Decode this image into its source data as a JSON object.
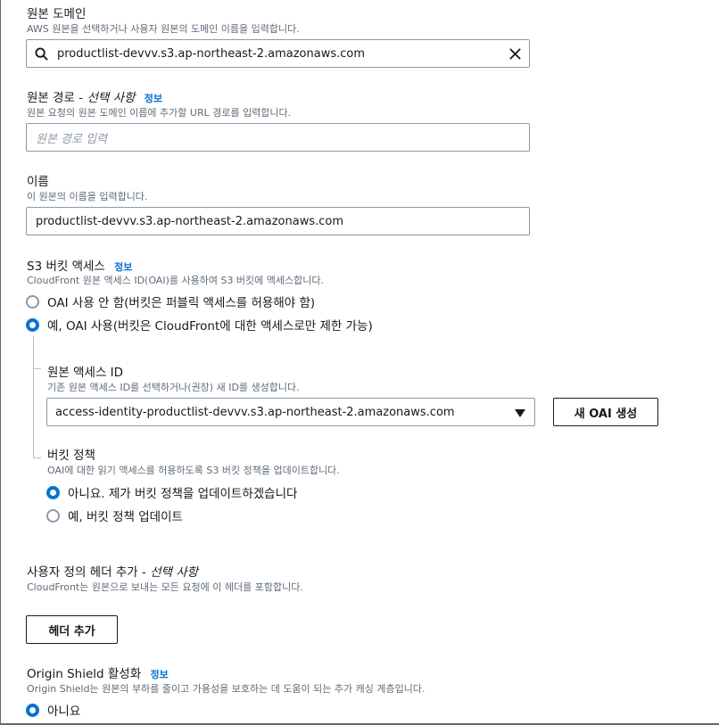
{
  "origin_domain": {
    "label": "원본 도메인",
    "description": "AWS 원본을 선택하거나 사용자 원본의 도메인 이름을 입력합니다.",
    "value": "productlist-devvv.s3.ap-northeast-2.amazonaws.com",
    "search_icon": "search-icon",
    "clear_icon": "close-icon"
  },
  "origin_path": {
    "label": "원본 경로 -",
    "optional": "선택 사항",
    "info": "정보",
    "description": "원본 요청의 원본 도메인 이름에 추가할 URL 경로를 입력합니다.",
    "placeholder": "원본 경로 입력"
  },
  "name": {
    "label": "이름",
    "description": "이 원본의 이름을 입력합니다.",
    "value": "productlist-devvv.s3.ap-northeast-2.amazonaws.com"
  },
  "s3_access": {
    "label": "S3 버킷 액세스",
    "info": "정보",
    "description": "CloudFront 원본 액세스 ID(OAI)를 사용하여 S3 버킷에 액세스합니다.",
    "options": [
      {
        "label": "OAI 사용 안 함(버킷은 퍼블릭 액세스를 허용해야 함)",
        "selected": false
      },
      {
        "label": "예, OAI 사용(버킷은 CloudFront에 대한 액세스로만 제한 가능)",
        "selected": true
      }
    ]
  },
  "oai": {
    "label": "원본 액세스 ID",
    "description": "기존 원본 액세스 ID를 선택하거나(권장) 새 ID를 생성합니다.",
    "selected": "access-identity-productlist-devvv.s3.ap-northeast-2.amazonaws.com",
    "create_button": "새 OAI 생성"
  },
  "bucket_policy": {
    "label": "버킷 정책",
    "description": "OAI에 대한 읽기 액세스를 허용하도록 S3 버킷 정책을 업데이트합니다.",
    "options": [
      {
        "label": "아니요. 제가 버킷 정책을 업데이트하겠습니다",
        "selected": true
      },
      {
        "label": "예, 버킷 정책 업데이트",
        "selected": false
      }
    ]
  },
  "custom_headers": {
    "label": "사용자 정의 헤더 추가 -",
    "optional": "선택 사항",
    "description": "CloudFront는 원본으로 보내는 모든 요청에 이 헤더를 포함합니다.",
    "add_button": "헤더 추가"
  },
  "origin_shield": {
    "label": "Origin Shield 활성화",
    "info": "정보",
    "description": "Origin Shield는 원본의 부하를 줄이고 가용성을 보호하는 데 도움이 되는 추가 캐싱 계층입니다.",
    "options": [
      {
        "label": "아니요",
        "selected": true
      }
    ]
  },
  "colors": {
    "accent": "#0972d3",
    "border": "#8d99a8",
    "text": "#16191f",
    "muted": "#5f6b7a"
  }
}
